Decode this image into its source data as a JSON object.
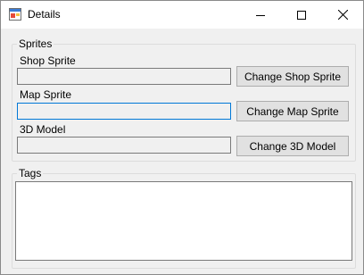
{
  "window": {
    "title": "Details",
    "icon": "app-window-icon",
    "controls": {
      "minimize": "minimize-icon",
      "maximize": "maximize-icon",
      "close": "close-icon"
    }
  },
  "sprites_group": {
    "label": "Sprites",
    "shop_sprite": {
      "label": "Shop Sprite",
      "value": "",
      "button": "Change Shop Sprite"
    },
    "map_sprite": {
      "label": "Map Sprite",
      "value": "",
      "button": "Change Map Sprite"
    },
    "model_3d": {
      "label": "3D Model",
      "value": "",
      "button": "Change 3D Model"
    }
  },
  "tags_group": {
    "label": "Tags",
    "value": ""
  },
  "colors": {
    "focus_border": "#0078d7",
    "window_bg": "#f0f0f0",
    "button_bg": "#e1e1e1"
  }
}
